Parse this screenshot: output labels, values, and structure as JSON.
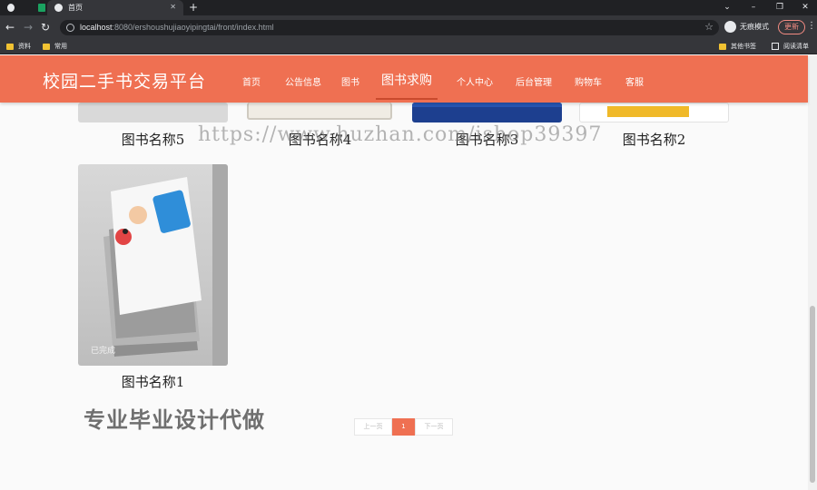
{
  "browser": {
    "tab_title": "首页",
    "url_host": "localhost",
    "url_rest": ":8080/ershoushujiaoyipingtai/front/index.html",
    "profile_label": "无痕模式",
    "update_label": "更新",
    "bookmarks": [
      "资料",
      "常用"
    ],
    "bookmarks_right": [
      "其他书签",
      "阅读清单"
    ]
  },
  "site": {
    "brand": "校园二手书交易平台",
    "nav": [
      "首页",
      "公告信息",
      "图书",
      "图书求购",
      "个人中心",
      "后台管理",
      "购物车",
      "客服"
    ],
    "active_nav": "图书求购"
  },
  "books": [
    {
      "title": "图书名称5"
    },
    {
      "title": "图书名称4"
    },
    {
      "title": "图书名称3"
    },
    {
      "title": "图书名称2"
    },
    {
      "title": "图书名称1"
    }
  ],
  "overlay": {
    "url_watermark": "https://www.huzhan.com/ishop39397",
    "promo": "专业毕业设计代做",
    "photo_caption": "已完成"
  },
  "pagination": {
    "prev": "上一页",
    "current": "1",
    "next": "下一页"
  },
  "colors": {
    "header": "#ef7052",
    "accent": "#ef7052"
  }
}
